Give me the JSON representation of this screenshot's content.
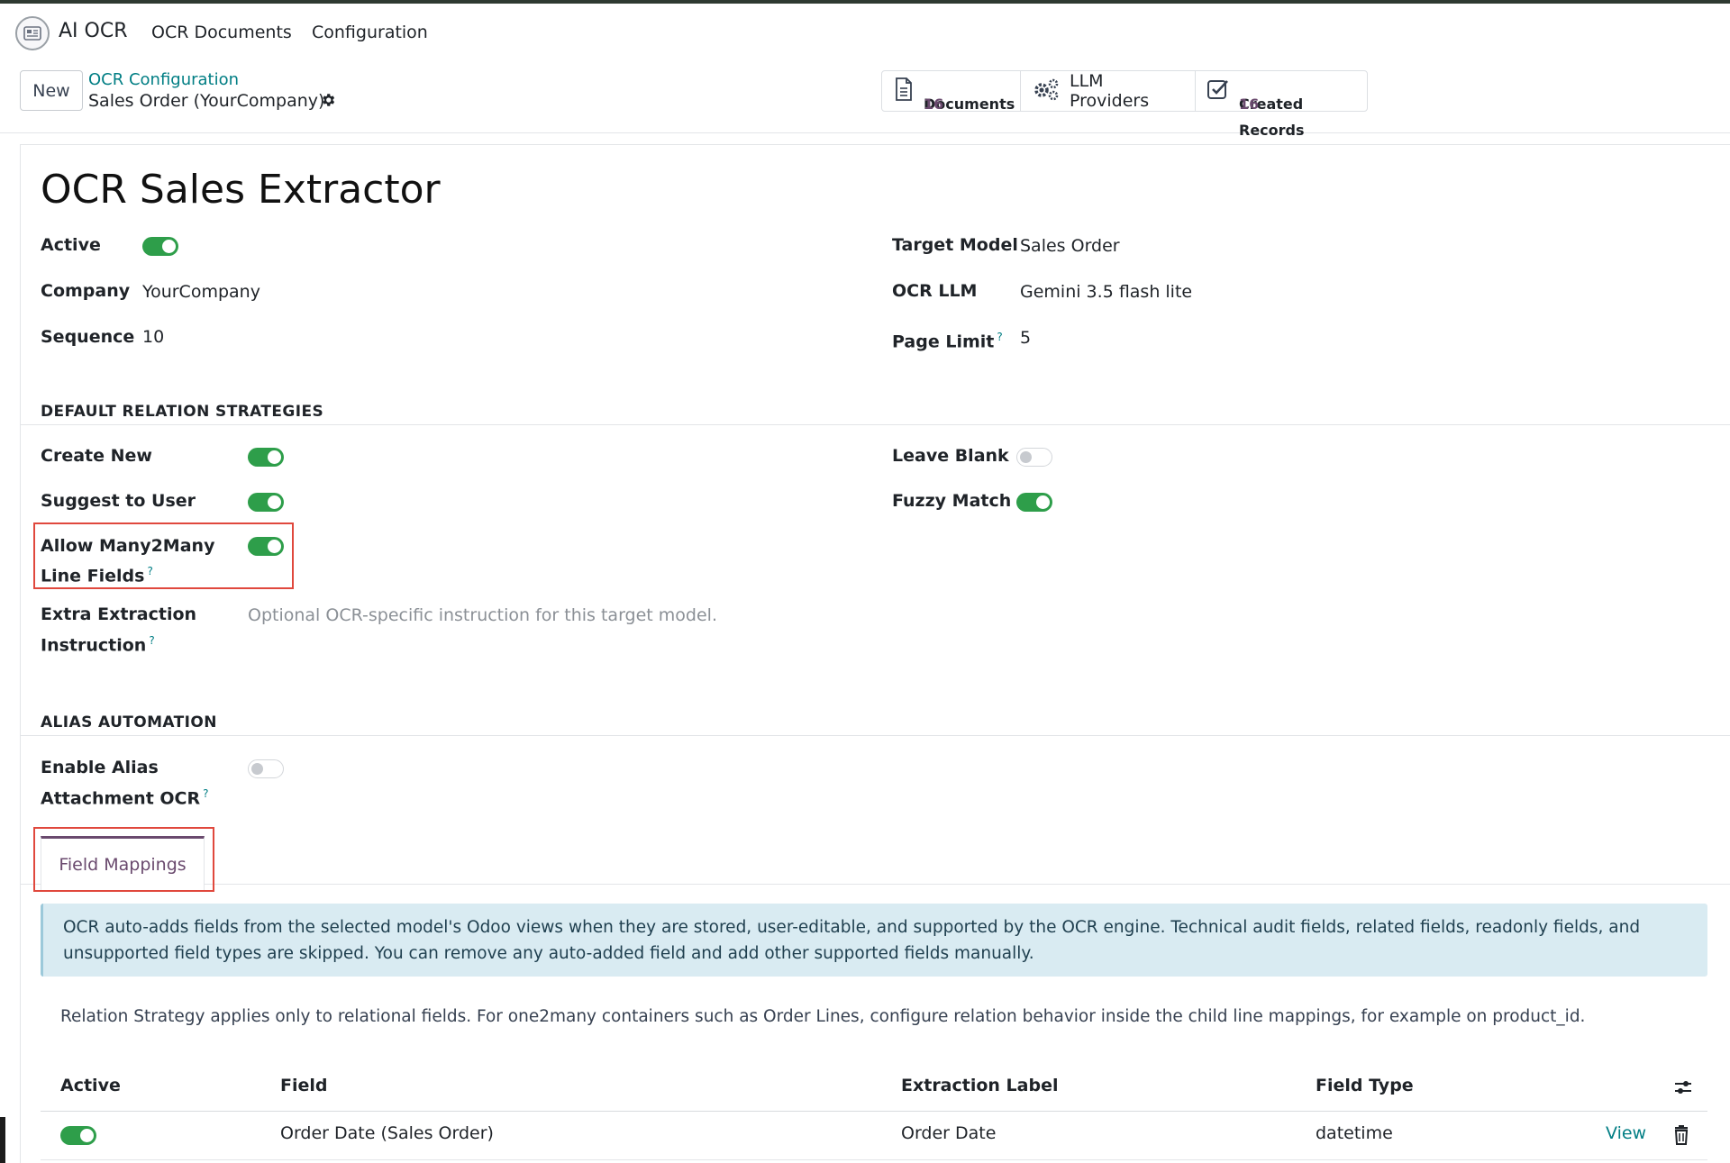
{
  "navbar": {
    "app_name": "AI OCR",
    "menu": [
      "OCR Documents",
      "Configuration"
    ]
  },
  "control_panel": {
    "new_label": "New",
    "breadcrumb_parent": "OCR Configuration",
    "breadcrumb_current": "Sales Order (YourCompany)",
    "smart_buttons": {
      "documents": {
        "label": "Documents",
        "value": "16"
      },
      "llm_providers": {
        "label": "LLM Providers"
      },
      "created_records": {
        "label": "Created Records",
        "value": "16"
      }
    }
  },
  "form": {
    "title": "OCR Sales Extractor",
    "left_fields": {
      "active_label": "Active",
      "active_value": true,
      "company_label": "Company",
      "company_value": "YourCompany",
      "sequence_label": "Sequence",
      "sequence_value": "10"
    },
    "right_fields": {
      "target_model_label": "Target Model",
      "target_model_value": "Sales Order",
      "ocr_llm_label": "OCR LLM",
      "ocr_llm_value": "Gemini 3.5 flash lite",
      "page_limit_label": "Page Limit",
      "page_limit_value": "5"
    },
    "default_relation": {
      "title": "DEFAULT RELATION STRATEGIES",
      "create_new_label": "Create New",
      "create_new_value": true,
      "suggest_label": "Suggest to User",
      "suggest_value": true,
      "m2m_label_line1": "Allow Many2Many",
      "m2m_label_line2": "Line Fields",
      "m2m_value": true,
      "leave_blank_label": "Leave Blank",
      "leave_blank_value": false,
      "fuzzy_label": "Fuzzy Match",
      "fuzzy_value": true,
      "extra_label_line1": "Extra Extraction",
      "extra_label_line2": "Instruction",
      "extra_placeholder": "Optional OCR-specific instruction for this target model."
    },
    "alias": {
      "title": "ALIAS AUTOMATION",
      "enable_label_line1": "Enable Alias",
      "enable_label_line2": "Attachment OCR",
      "enable_value": false
    },
    "help_mark": "?"
  },
  "tabs": {
    "field_mappings": "Field Mappings"
  },
  "alert": {
    "line1": "OCR auto-adds fields from the selected model's Odoo views when they are stored, user-editable, and supported by the OCR engine. Technical audit fields, related fields, readonly fields, and",
    "line2": "unsupported field types are skipped. You can remove any auto-added field and add other supported fields manually."
  },
  "note": "Relation Strategy applies only to relational fields. For one2many containers such as Order Lines, configure relation behavior inside the child line mappings, for example on product_id.",
  "table": {
    "columns": [
      "Active",
      "Field",
      "Extraction Label",
      "Field Type"
    ],
    "rows": [
      {
        "active": true,
        "field": "Order Date (Sales Order)",
        "extraction_label": "Order Date",
        "field_type": "datetime",
        "action": "View"
      }
    ]
  },
  "colors": {
    "accent": "#6a4a6e",
    "link": "#017e84",
    "toggle_on": "#2e9e4a",
    "highlight": "#e0483d",
    "alert_bg": "#d9ebf2"
  },
  "icons": [
    "app-logo-icon",
    "gear-icon",
    "document-icon",
    "cogs-icon",
    "checkbox-icon",
    "column-settings-icon",
    "trash-icon"
  ]
}
